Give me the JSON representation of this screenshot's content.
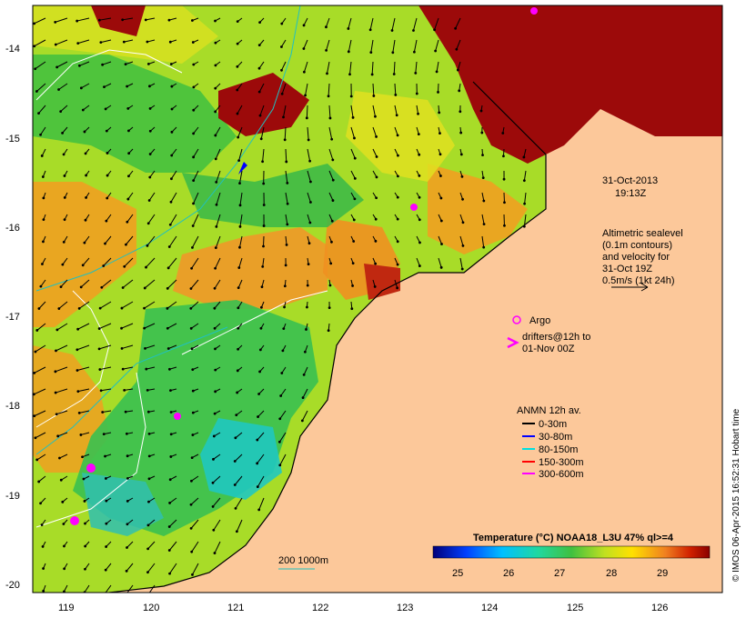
{
  "map": {
    "timestamp_date": "31-Oct-2013",
    "timestamp_time": "19:13Z",
    "altimetry_note": [
      "Altimetric sealevel",
      "(0.1m contours)",
      "and velocity for",
      "31-Oct 19Z",
      "0.5m/s (1kt 24h)"
    ],
    "argo_label": "Argo",
    "drifter_label": [
      "drifters@12h to",
      "01-Nov 00Z"
    ],
    "anmn_title": "ANMN 12h av.",
    "anmn_legend": [
      {
        "label": "0-30m",
        "color": "#000000"
      },
      {
        "label": "30-80m",
        "color": "#0000ff"
      },
      {
        "label": "80-150m",
        "color": "#00e0e0"
      },
      {
        "label": "150-300m",
        "color": "#ff0000"
      },
      {
        "label": "300-600m",
        "color": "#ff00ff"
      }
    ],
    "depth_contour_label": "200  1000m",
    "colorbar_title": "Temperature (°C) NOAA18_L3U 47% ql>=4",
    "colorbar_ticks": [
      "25",
      "26",
      "27",
      "28",
      "29"
    ],
    "credit": "© IMOS 06-Apr-2015 16:52:31 Hobart time",
    "lat_ticks": [
      "-14",
      "-15",
      "-16",
      "-17",
      "-18",
      "-19",
      "-20"
    ],
    "lon_ticks": [
      "119",
      "120",
      "121",
      "122",
      "123",
      "124",
      "125",
      "126"
    ],
    "colors": {
      "land": "#fcc89a",
      "ocean_warm": "#f0a020",
      "ocean_mid": "#b8e020",
      "ocean_cool": "#40c040",
      "ocean_cold": "#20c0c0",
      "hot_red": "#9c0a0a"
    }
  }
}
